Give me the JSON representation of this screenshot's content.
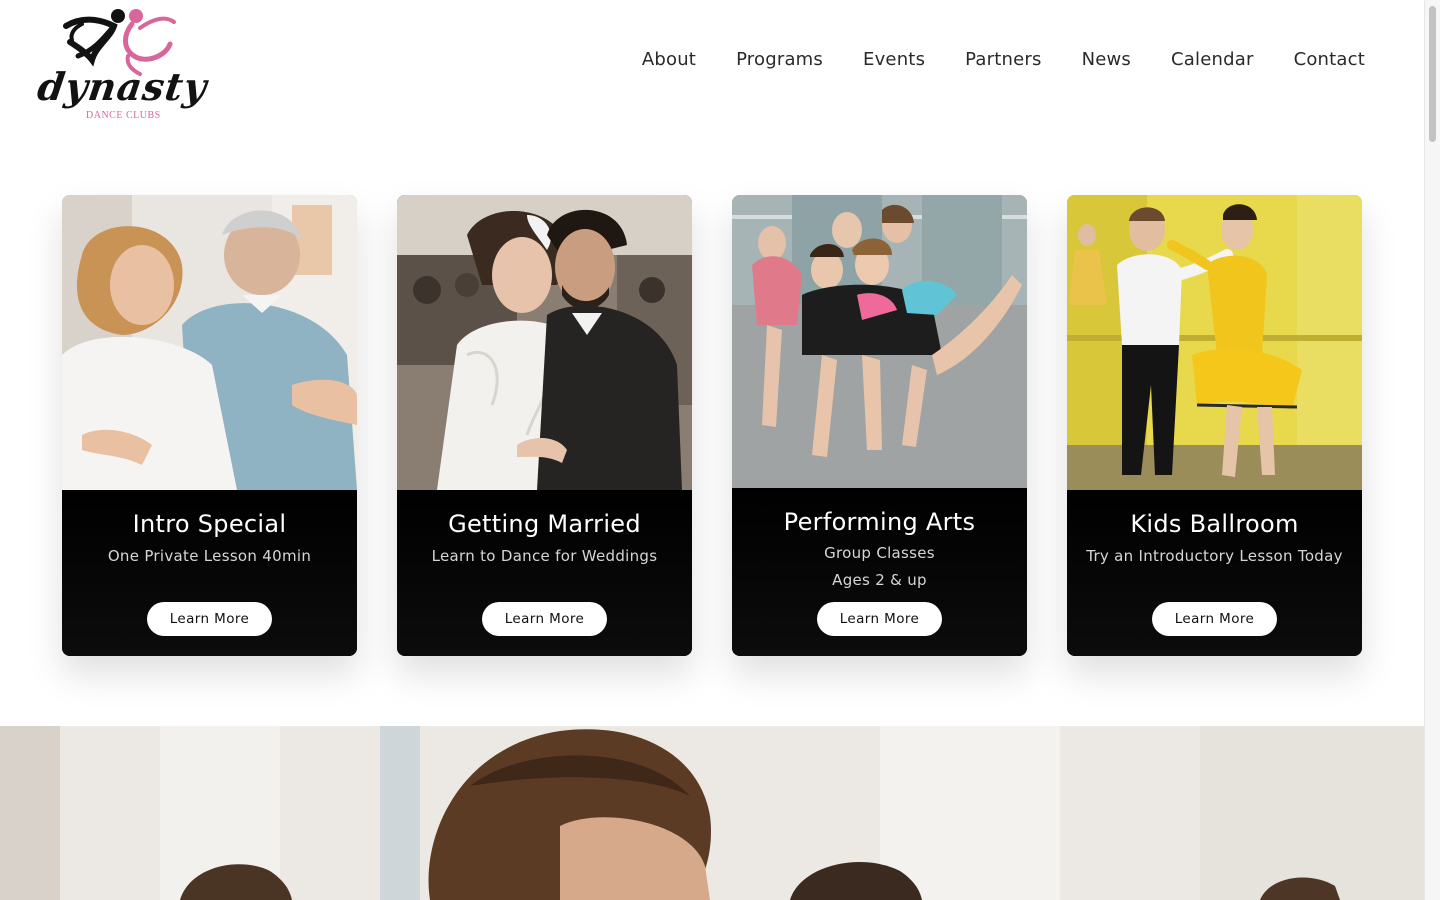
{
  "brand": {
    "name": "dynasty",
    "tagline": "DANCE CLUBS",
    "accent_color": "#d8669a"
  },
  "nav": {
    "items": [
      "About",
      "Programs",
      "Events",
      "Partners",
      "News",
      "Calendar",
      "Contact"
    ]
  },
  "cards": [
    {
      "title": "Intro Special",
      "subtitle": "One Private Lesson 40min",
      "button": "Learn More"
    },
    {
      "title": "Getting Married",
      "subtitle": "Learn to Dance for Weddings",
      "button": "Learn More"
    },
    {
      "title": "Performing Arts",
      "subtitle": "Group Classes",
      "subtitle2": "Ages 2 & up",
      "button": "Learn More"
    },
    {
      "title": "Kids Ballroom",
      "subtitle": "Try an Introductory Lesson Today",
      "button": "Learn More"
    }
  ]
}
